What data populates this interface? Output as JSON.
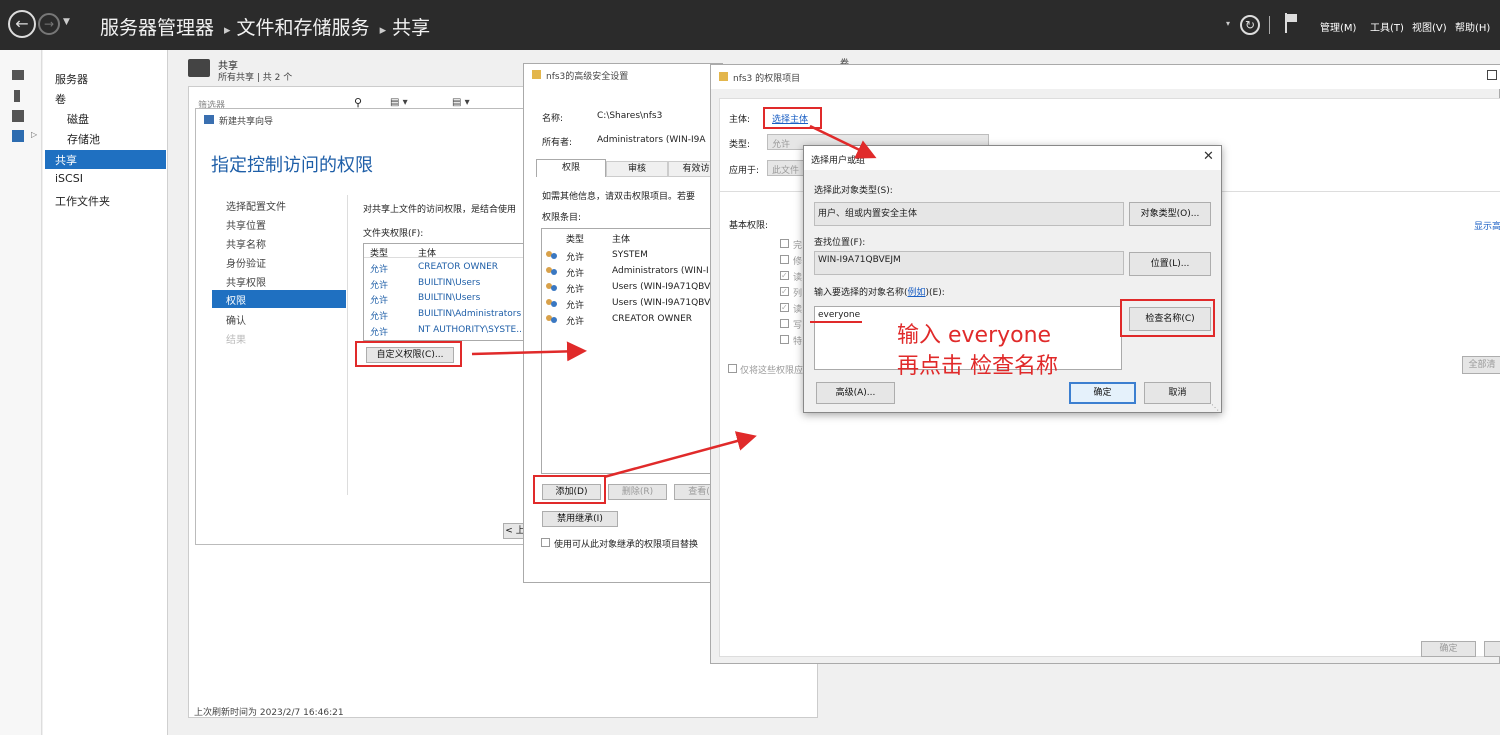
{
  "topbar": {
    "breadcrumb": [
      "服务器管理器",
      "文件和存储服务",
      "共享"
    ],
    "menus": [
      "管理(M)",
      "工具(T)",
      "视图(V)",
      "帮助(H)"
    ]
  },
  "nav": {
    "items": [
      "服务器",
      "卷",
      "磁盘",
      "存储池",
      "共享",
      "iSCSI",
      "工作文件夹"
    ],
    "selected": "共享"
  },
  "shares": {
    "title": "共享",
    "subtitle": "所有共享 | 共 2 个",
    "filter_placeholder": "筛选器",
    "status": "上次刷新时间为 2023/2/7 16:46:21",
    "right_label": "卷"
  },
  "wizard": {
    "window_title": "新建共享向导",
    "heading": "指定控制访问的权限",
    "steps": [
      "选择配置文件",
      "共享位置",
      "共享名称",
      "身份验证",
      "共享权限",
      "权限",
      "确认",
      "结果"
    ],
    "selected_step": "权限",
    "description": "对共享上文件的访问权限，是结合使用",
    "folder_perm_label": "文件夹权限(F):",
    "columns": [
      "类型",
      "主体"
    ],
    "rows": [
      {
        "type": "允许",
        "principal": "CREATOR OWNER"
      },
      {
        "type": "允许",
        "principal": "BUILTIN\\Users"
      },
      {
        "type": "允许",
        "principal": "BUILTIN\\Users"
      },
      {
        "type": "允许",
        "principal": "BUILTIN\\Administrators"
      },
      {
        "type": "允许",
        "principal": "NT AUTHORITY\\SYSTE..."
      }
    ],
    "custom_button": "自定义权限(C)...",
    "prev_button": "< 上"
  },
  "adv": {
    "window_title": "nfs3的高级安全设置",
    "name_label": "名称:",
    "name_value": "C:\\Shares\\nfs3",
    "owner_label": "所有者:",
    "owner_value": "Administrators (WIN-I9A",
    "tabs": [
      "权限",
      "审核",
      "有效访"
    ],
    "info": "如需其他信息，请双击权限项目。若要",
    "entries_label": "权限条目:",
    "columns": [
      "类型",
      "主体"
    ],
    "rows": [
      {
        "type": "允许",
        "principal": "SYSTEM"
      },
      {
        "type": "允许",
        "principal": "Administrators (WIN-I"
      },
      {
        "type": "允许",
        "principal": "Users (WIN-I9A71QBV"
      },
      {
        "type": "允许",
        "principal": "Users (WIN-I9A71QBV"
      },
      {
        "type": "允许",
        "principal": "CREATOR OWNER"
      }
    ],
    "add_button": "添加(D)",
    "remove_button": "删除(R)",
    "view_button": "查看(",
    "disable_inherit_button": "禁用继承(I)",
    "replace_checkbox": "使用可从此对象继承的权限项目替换"
  },
  "perm": {
    "window_title": "nfs3 的权限项目",
    "principal_label": "主体:",
    "select_principal_link": "选择主体",
    "type_label": "类型:",
    "type_value": "允许",
    "applies_label": "应用于:",
    "applies_value": "此文件",
    "basic_label": "基本权限:",
    "perms": [
      "完",
      "修",
      "读",
      "列",
      "读",
      "写",
      "特"
    ],
    "only_apply": "仅将这些权限应",
    "show_advanced": "显示高",
    "clear_all": "全部清",
    "ok_button": "确定"
  },
  "select": {
    "window_title": "选择用户或组",
    "object_type_label": "选择此对象类型(S):",
    "object_type_value": "用户、组或内置安全主体",
    "object_type_button": "对象类型(O)...",
    "location_label": "查找位置(F):",
    "location_value": "WIN-I9A71QBVEJM",
    "location_button": "位置(L)...",
    "enter_label_prefix": "输入要选择的对象名称(",
    "example_link": "例如",
    "enter_label_suffix": ")(E):",
    "input_value": "everyone",
    "check_button": "检查名称(C)",
    "advanced_button": "高级(A)...",
    "ok_button": "确定",
    "cancel_button": "取消"
  },
  "annotation": {
    "line1": "输入 everyone",
    "line2": "再点击 检查名称",
    "color": "#e02a2a"
  }
}
